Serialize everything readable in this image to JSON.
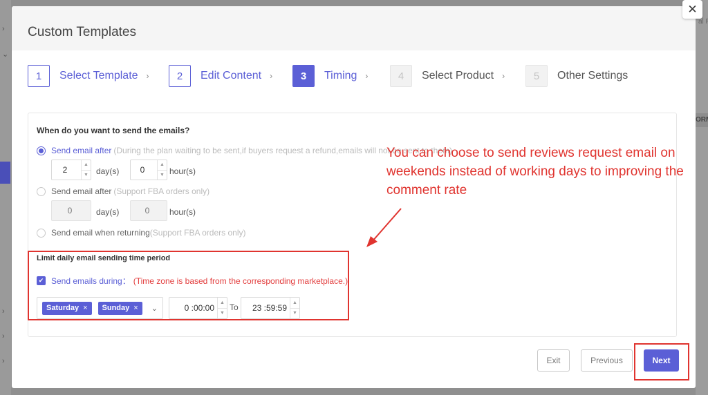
{
  "modal": {
    "title": "Custom Templates",
    "close_glyph": "✕"
  },
  "background": {
    "right_label": "ORM",
    "right_label_top": "al R"
  },
  "steps": [
    {
      "number": "1",
      "label": "Select Template",
      "state": "done"
    },
    {
      "number": "2",
      "label": "Edit Content",
      "state": "done"
    },
    {
      "number": "3",
      "label": "Timing",
      "state": "active"
    },
    {
      "number": "4",
      "label": "Select Product",
      "state": "disabled"
    },
    {
      "number": "5",
      "label": "Other Settings",
      "state": "disabled"
    }
  ],
  "timing": {
    "question": "When do you want to send the emails?",
    "option1": {
      "label": "Send email after",
      "hint": "(During the plan waiting to be sent,if buyers request a refund,emails will not be sent to them)",
      "days": "2",
      "hours": "0",
      "checked": true
    },
    "option2": {
      "label": "Send email after",
      "hint": "(Support FBA orders only)",
      "days": "0",
      "hours": "0",
      "checked": false
    },
    "option3": {
      "label": "Send email when returning",
      "hint": "(Support FBA orders only)",
      "checked": false
    },
    "unit_days": "day(s)",
    "unit_hours": "hour(s)"
  },
  "limit": {
    "title": "Limit daily email sending time period",
    "checkbox_label": "Send emails during：",
    "timezone_note": "(Time zone is based from the corresponding marketplace.)",
    "days_selected": [
      "Saturday",
      "Sunday"
    ],
    "tag_remove_glyph": "×",
    "start_time": "0 :00:00",
    "to_label": "To",
    "end_time": "23 :59:59"
  },
  "annotation": {
    "text": "You can choose to send reviews request email on weekends instead of working days to improving the comment rate",
    "color": "#e0342f"
  },
  "footer": {
    "exit_label": "Exit",
    "previous_label": "Previous",
    "next_label": "Next"
  },
  "colors": {
    "accent": "#5b5fd6",
    "annotation_red": "#e0342f"
  }
}
